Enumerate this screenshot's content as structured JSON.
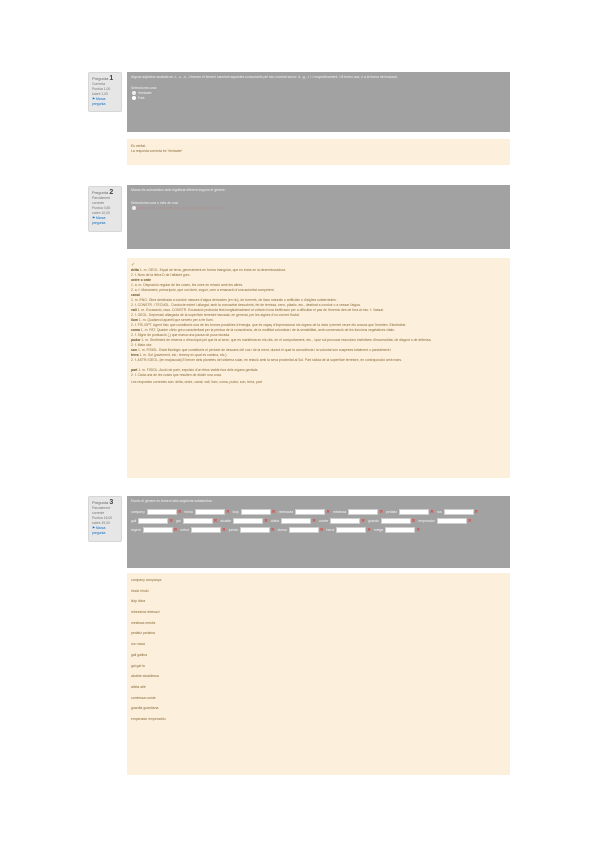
{
  "q1": {
    "info": {
      "label": "Pregunta",
      "number": "1",
      "status": "Correcta",
      "score": "Puntúa 1,00 sobre 1,00",
      "flag": "Marca pregunta"
    },
    "text": "Alguns adjectius acabats en -t, -c, -n, -l formen el femení canviant aquestes consonants pel seu correlat sonor: d, -g, -r i -l respectivament. Ull tenen una, o a la forma del masculí.",
    "prompt": "Seleccioneu una:",
    "options": [
      "Verdader",
      "Fals"
    ],
    "feedback": [
      "Es veritat.",
      "La resposta correcta és 'Verdader'"
    ]
  },
  "q2": {
    "info": {
      "label": "Pregunta",
      "number": "2",
      "status": "Parcialment correcte",
      "score": "Puntúa 0,80 sobre 10,00",
      "flag": "Marca pregunta"
    },
    "text": "Marca els substantius amb significat diferent segons el gènere:",
    "prompt": "Seleccioneu una o més de una:",
    "selected_link": "delta, ordre, canal, vall, llum, coma, pudor, son, terra, part",
    "feedback_mark": "✓",
    "definitions": [
      {
        "term": "delta",
        "text": " 1. m. GEOL. Espai de terra, generalment en forma triangular, que es troba en la desembocadura."
      },
      {
        "term": "",
        "text": "2. f. Nom de la lletra D de l'alfabet grec."
      },
      {
        "term": "ordre o orde",
        "text": ""
      },
      {
        "term": "",
        "text": "1. a. m. Disposició regular de les coses, les unes en relació amb les altres."
      },
      {
        "term": "",
        "text": "2. a. f. Manament, prescripció, que cal obeir, seguir, com a emanació d'una autoritat competent."
      },
      {
        "term": "canal",
        "text": ""
      },
      {
        "term": "",
        "text": "1. m. ENG. Obra destinada a conduir masses d'aigua derivades (en riu), de torrents, de llacs naturals o artificials o d'aigües subterrànies."
      },
      {
        "term": "",
        "text": "2. f. CONSTR. i TECNOL. Conducte estret i allargat, amb la concavitat descobrint, fet de terrissa, zenc, plàstic, etc., destinat a conduir o a vessar l'aigua."
      },
      {
        "term": "vall",
        "text": " 1. m. Excavació, rasa. CONSTR. Excavació profunda feta longitudinalment al voltant d'una fortificació per a dificultar el pas de l'enemic des de fora al mur. f. Vassal."
      },
      {
        "term": "",
        "text": "2. f. GEOL. Depressió allargada de la superfície terrestre tancada, en general, per les aigües d'un corrent fluvial."
      },
      {
        "term": "llum",
        "text": " 1. m. Qualsevol aparell que serveix per a fer llum."
      },
      {
        "term": "",
        "text": "2. f. FÍS./OPT. Agent físic que constitueix una de les formes possibles d'energia, que és capaç d'impressionar els òrgans de la vista i permet veure els cossos que l'emeten. Electricitat."
      },
      {
        "term": "coma",
        "text": " 1. m. PAT. Quadre clínic greu caracteritzat per la pèrdua de la consciència, de la motilitat voluntària i de la sensibilitat, amb conservació de les funcions vegetatives vitals."
      },
      {
        "term": "",
        "text": "2. f. Signe de puntuació (,) que marca una pausa de poca durada."
      },
      {
        "term": "pudor",
        "text": " 1. m. Sentiment de reserva o d'escrúpol pel que fa al sexe, que es manifesta en els ulls, en el comportament, etc., i que sol provocar reaccions instintives d'incomoditat, de disgust o de defensa."
      },
      {
        "term": "",
        "text": "2. f. Mala olor."
      },
      {
        "term": "son",
        "text": " 1. m. FISIOL. Estat fisiològic que constitueix el període de descans del cos i de la ment, durant el qual la consciència i la voluntat són suspeses totalment o parcialment i"
      },
      {
        "term": "terra",
        "text": " 1. m. Sol (pavement, etc.; terreny en qual es camina, etc.)"
      },
      {
        "term": "",
        "text": "2. f. ASTR./GEOL. [en majúscula] El tercer dels planetes del sistema solar, en relació amb la seva proximitat al Sol. Part sòlida de la superfície terrestre, en contraposició amb mars."
      },
      {
        "term": "",
        "text": ""
      },
      {
        "term": "part",
        "text": " 1. m. FISIOL. Acció de parir, expulsió d'un fetus viable fora dels òrgans genitals."
      },
      {
        "term": "",
        "text": "2. f. Cada una de les coses que resulten de dividir una cosa."
      }
    ],
    "correct_answer": "Les respostes correctes són: delta, ordre, canal, vall, llum, coma, pudor, son, terra, part"
  },
  "q3": {
    "info": {
      "label": "Pregunta",
      "number": "3",
      "status": "Parcialment correcte",
      "score": "Puntúa 16,00 sobre 19,00",
      "flag": "Marca pregunta"
    },
    "text": "Escriu el gènere en femení dels següents substantius:",
    "gaps": [
      "company",
      "hindú",
      "lluip",
      "rebesàvia",
      "mestissa",
      "pedaitz",
      "rus",
      "gall",
      "gal",
      "alcalde",
      "atleta",
      "comte",
      "guarda",
      "emperador",
      "regent",
      "nebot",
      "jurista",
      "duesa",
      "heroi",
      "metge"
    ],
    "answers": [
      "company companya",
      "hindú hindú",
      "lluip lloba",
      "rebesàvia rebesavi",
      "mestissa mestís",
      "pedaitz pedaina",
      "rus russa",
      "gall gallina",
      "gal gal·la",
      "alcalde alcaldessa",
      "atleta atlè",
      "comtessa comte",
      "guardià guardiana",
      "emperador emperadriu"
    ]
  }
}
